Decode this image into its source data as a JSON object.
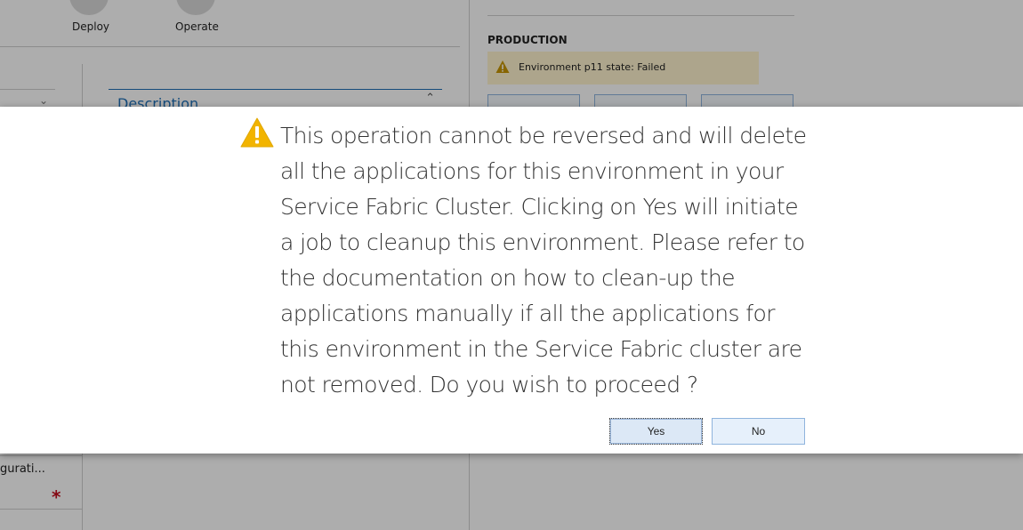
{
  "toolbar": {
    "deploy_label": "Deploy",
    "operate_label": "Operate"
  },
  "production": {
    "section_title": "PRODUCTION",
    "status_message": "Environment p11 state: Failed",
    "status_color": "#fff4ce",
    "warning_icon": "warning-icon"
  },
  "description_panel": {
    "title": "Description"
  },
  "left_panel": {
    "config_text": "gurati...",
    "required_marker": "*"
  },
  "dialog": {
    "icon": "warning-icon",
    "message": "This operation cannot be reversed and will delete all the applications for this environment in your Service Fabric Cluster. Clicking on Yes will initiate a job to cleanup this environment. Please refer to the documentation on how to clean-up the applications manually if all the applications for this environment in the Service Fabric cluster are not removed. Do you wish to proceed ?",
    "yes_label": "Yes",
    "no_label": "No"
  },
  "colors": {
    "accent": "#1f6fb5",
    "warning": "#f2b400",
    "required": "#c50f1f"
  }
}
